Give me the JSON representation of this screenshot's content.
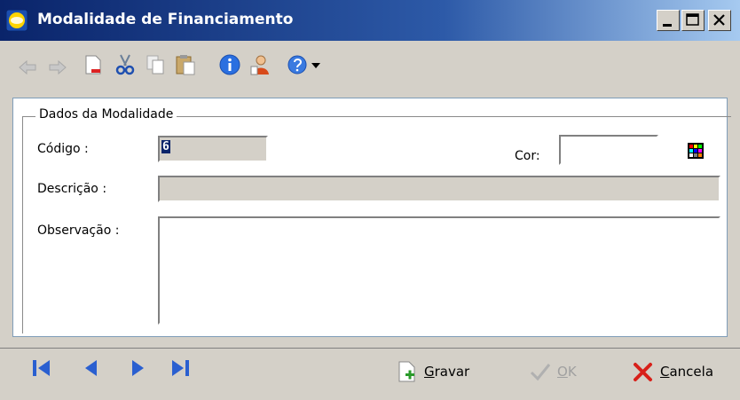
{
  "window": {
    "title": "Modalidade de Financiamento"
  },
  "toolbar": {
    "icons": [
      "back-icon",
      "forward-icon",
      "new-document-icon",
      "cut-icon",
      "copy-icon",
      "paste-icon",
      "info-icon",
      "user-icon",
      "help-icon"
    ]
  },
  "group": {
    "legend": "Dados da Modalidade",
    "codigo_label": "Código :",
    "codigo_value": "6",
    "cor_label": "Cor:",
    "descricao_label": "Descrição :",
    "observacao_label": "Observação :"
  },
  "footer": {
    "gravar_underline": "G",
    "gravar_rest": "ravar",
    "ok_underline": "O",
    "ok_rest": "K",
    "cancela_underline": "C",
    "cancela_rest": "ancela"
  }
}
